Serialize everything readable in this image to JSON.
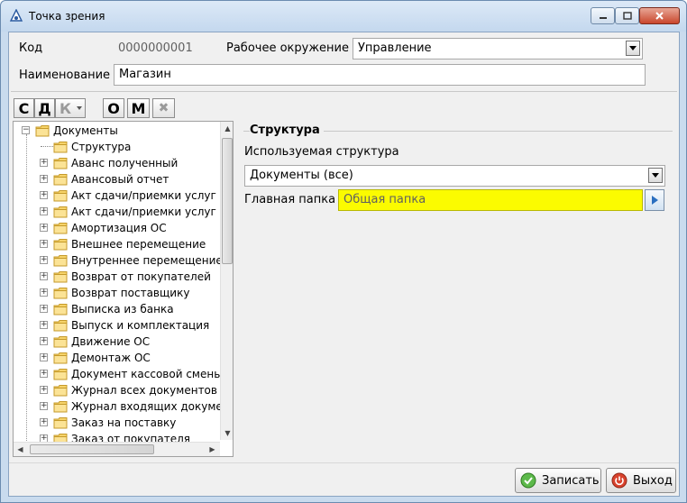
{
  "window": {
    "title": "Точка зрения"
  },
  "form": {
    "code_label": "Код",
    "code_value": "0000000001",
    "environment_label": "Рабочее окружение",
    "environment_value": "Управление",
    "name_label": "Наименование",
    "name_value": "Магазин"
  },
  "toolbar": {
    "buttons": [
      "С",
      "Д",
      "К",
      "О",
      "М",
      "✖"
    ]
  },
  "tree": {
    "root": "Документы",
    "items": [
      "Структура",
      "Аванс полученный",
      "Авансовый отчет",
      "Акт сдачи/приемки услуг (вх",
      "Акт сдачи/приемки услуг (ис",
      "Амортизация ОС",
      "Внешнее перемещение",
      "Внутреннее перемещение",
      "Возврат от покупателей",
      "Возврат поставщику",
      "Выписка из банка",
      "Выпуск и комплектация",
      "Движение ОС",
      "Демонтаж ОС",
      "Документ кассовой смены",
      "Журнал всех документов",
      "Журнал входящих документ",
      "Заказ на поставку",
      "Заказ от покупателя"
    ]
  },
  "structure": {
    "group_title": "Структура",
    "used_structure_label": "Используемая структура",
    "used_structure_value": "Документы (все)",
    "main_folder_label": "Главная папка",
    "main_folder_placeholder": "Общая папка"
  },
  "footer": {
    "save_label": "Записать",
    "exit_label": "Выход"
  },
  "colors": {
    "highlight_field": "#fbfb00",
    "window_frame": "#c9dbee"
  }
}
